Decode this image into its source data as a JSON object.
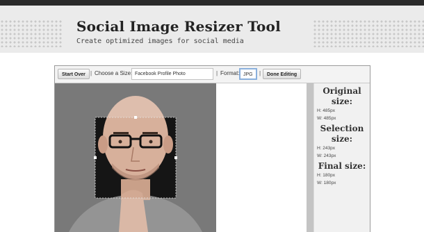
{
  "header": {
    "title": "Social Image Resizer Tool",
    "subtitle": "Create optimized images for social media"
  },
  "toolbar": {
    "start_over": "Start Over",
    "choose_size_label": "Choose a Size:",
    "size_value": "Facebook Profile Photo",
    "format_label": "Format:",
    "format_value": "JPG",
    "done_editing": "Done Editing",
    "separator": "|"
  },
  "sidebar": {
    "original": {
      "heading": "Original size:",
      "height": "H: 485px",
      "width": "W: 485px"
    },
    "selection": {
      "heading": "Selection size:",
      "height": "H: 243px",
      "width": "W: 243px"
    },
    "final": {
      "heading": "Final size:",
      "height": "H: 180px",
      "width": "W: 180px"
    }
  },
  "colors": {
    "canvas_bg": "#5c5c5c",
    "header_bg": "#ebebeb",
    "focus_border": "#8ab0dd"
  }
}
